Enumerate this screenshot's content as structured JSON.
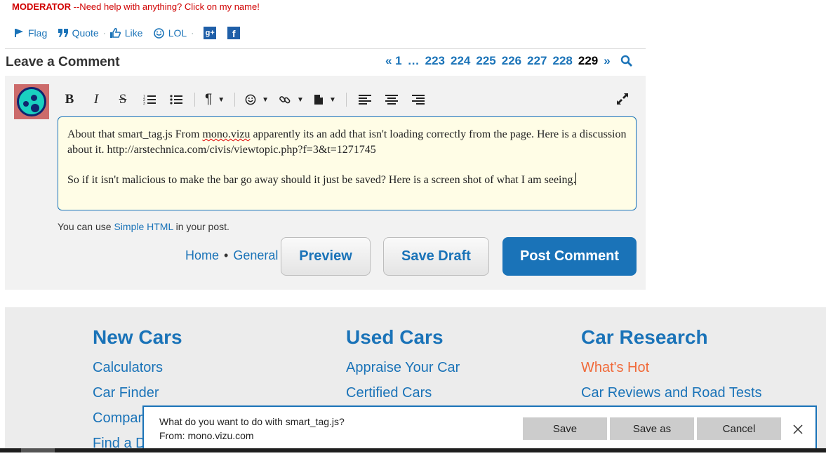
{
  "moderator": {
    "role": "MODERATOR",
    "text": " --Need help with anything? Click on my name!"
  },
  "actions": {
    "flag": "Flag",
    "quote": "Quote",
    "like": "Like",
    "lol": "LOL",
    "gplus": "g+",
    "fb": "f"
  },
  "comment_header": "Leave a Comment",
  "pager": {
    "first": "« 1",
    "ellipsis": "…",
    "pages": [
      "223",
      "224",
      "225",
      "226",
      "227",
      "228"
    ],
    "current": "229",
    "next": "»"
  },
  "editor": {
    "line1_pre": "About that smart_tag.js  From ",
    "line1_link": "mono.vizu",
    "line1_post": " apparently its an add that isn't loading correctly from the page. Here is a discussion about it. http://arstechnica.com/civis/viewtopic.php?f=3&t=1271745",
    "line2": "So if it isn't malicious to make the bar go away should it just be saved? Here is a screen shot of what I am seeing."
  },
  "hint": {
    "pre": "You can use ",
    "link": "Simple HTML",
    "post": " in your post."
  },
  "crumbs": {
    "home": "Home",
    "sep": "•",
    "general": "General"
  },
  "buttons": {
    "preview": "Preview",
    "save_draft": "Save Draft",
    "post": "Post Comment"
  },
  "footer": {
    "col1": {
      "title": "New Cars",
      "links": [
        "Calculators",
        "Car Finder",
        "Compar",
        "Find a D"
      ]
    },
    "col2": {
      "title": "Used Cars",
      "links": [
        "Appraise Your Car",
        "Certified Cars"
      ]
    },
    "col3": {
      "title": "Car Research",
      "links": [
        "What's Hot",
        "Car Reviews and Road Tests"
      ]
    }
  },
  "download": {
    "question": "What do you want to do with smart_tag.js?",
    "from": "From: mono.vizu.com",
    "save": "Save",
    "save_as": "Save as",
    "cancel": "Cancel"
  }
}
